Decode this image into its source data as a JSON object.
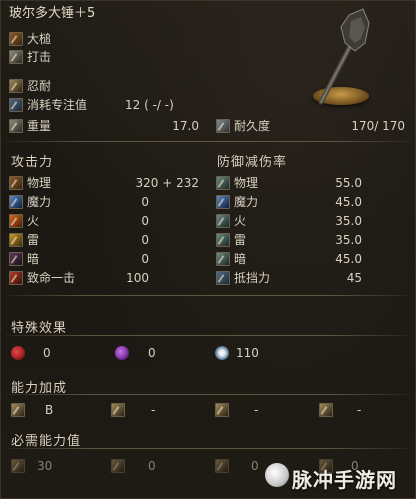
{
  "weapon": {
    "name": "玻尔多大锤＋5",
    "weapon_type": "大槌",
    "attack_type": "打击",
    "skill": "忍耐",
    "fp_label": "消耗专注值",
    "fp_value": "12 (   -/   -)",
    "weight_label": "重量",
    "weight_value": "17.0",
    "durability_label": "耐久度",
    "durability_value": "170/  170"
  },
  "attack": {
    "header": "攻击力",
    "rows": [
      {
        "label": "物理",
        "value": "320 +   232",
        "icon": "physical-icon"
      },
      {
        "label": "魔力",
        "value": "0",
        "icon": "magic-icon"
      },
      {
        "label": "火",
        "value": "0",
        "icon": "fire-icon"
      },
      {
        "label": "雷",
        "value": "0",
        "icon": "lightning-icon"
      },
      {
        "label": "暗",
        "value": "0",
        "icon": "dark-icon"
      },
      {
        "label": "致命一击",
        "value": "100",
        "icon": "critical-icon"
      }
    ]
  },
  "defense": {
    "header": "防御减伤率",
    "rows": [
      {
        "label": "物理",
        "value": "55.0",
        "icon": "physical-guard-icon"
      },
      {
        "label": "魔力",
        "value": "45.0",
        "icon": "magic-guard-icon"
      },
      {
        "label": "火",
        "value": "35.0",
        "icon": "fire-guard-icon"
      },
      {
        "label": "雷",
        "value": "35.0",
        "icon": "lightning-guard-icon"
      },
      {
        "label": "暗",
        "value": "45.0",
        "icon": "dark-guard-icon"
      },
      {
        "label": "抵挡力",
        "value": "45",
        "icon": "stability-icon"
      }
    ]
  },
  "effects": {
    "header": "特殊效果",
    "items": [
      {
        "value": "0",
        "icon": "bleed-icon",
        "color": "#b0242a"
      },
      {
        "value": "0",
        "icon": "poison-icon",
        "color": "#8a3ab0"
      },
      {
        "value": "110",
        "icon": "frost-icon",
        "color": "#dfe8f0"
      }
    ]
  },
  "scaling": {
    "header": "能力加成",
    "items": [
      {
        "value": "B",
        "icon": "strength-icon"
      },
      {
        "value": "-",
        "icon": "dexterity-icon"
      },
      {
        "value": "-",
        "icon": "intelligence-icon"
      },
      {
        "value": "-",
        "icon": "faith-icon"
      }
    ]
  },
  "requirements": {
    "header": "必需能力值",
    "items": [
      {
        "value": "30",
        "icon": "strength-req-icon"
      },
      {
        "value": "0",
        "icon": "dexterity-req-icon"
      },
      {
        "value": "0",
        "icon": "intelligence-req-icon"
      },
      {
        "value": "0",
        "icon": "faith-req-icon"
      }
    ]
  },
  "watermark": {
    "text": "脉冲手游网"
  }
}
